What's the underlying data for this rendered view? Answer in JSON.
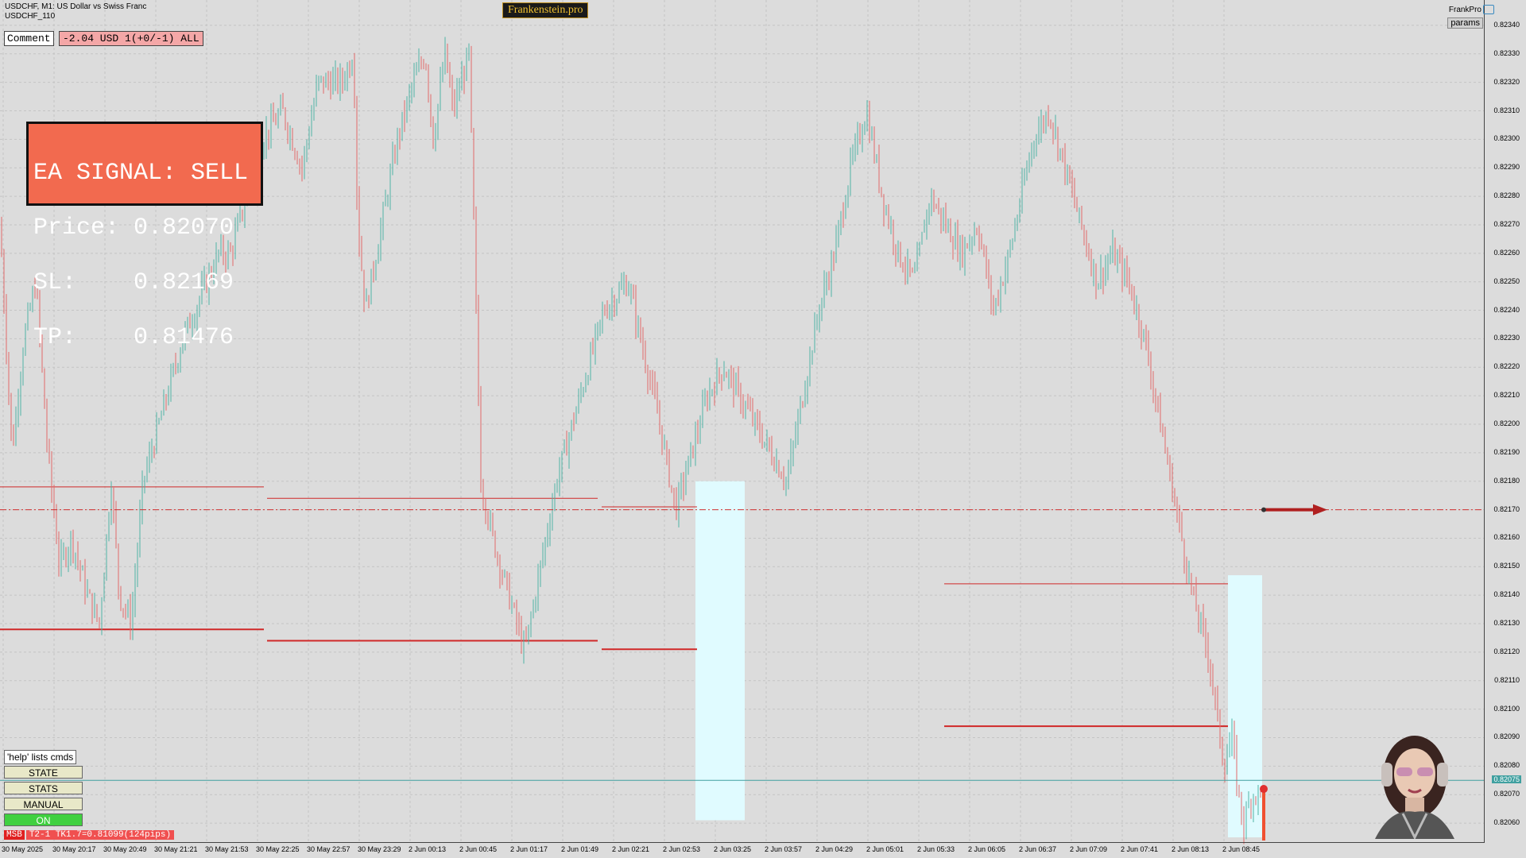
{
  "header": {
    "symbol_line": "USDCHF, M1:  US Dollar vs Swiss Franc",
    "sub_line": "USDCHF_110",
    "brand": "Frankenstein.pro",
    "frankpro_label": "FrankPro",
    "params_label": "params"
  },
  "comment": {
    "label": "Comment",
    "value": "-2.04 USD 1(+0/-1) ALL"
  },
  "signal": {
    "line1": "EA SIGNAL: SELL",
    "line2": "Price: 0.82070",
    "line3": "SL:    0.82169",
    "line4": "TP:    0.81476"
  },
  "panel": {
    "help": "'help' lists cmds",
    "state": "STATE",
    "stats": "STATS",
    "manual": "MANUAL",
    "on": "ON"
  },
  "status": {
    "tag": "MSB",
    "text": "T2-1  TK1.7=0.81099(124pips)"
  },
  "price_axis": {
    "labels": [
      "0.82340",
      "0.82330",
      "0.82320",
      "0.82310",
      "0.82300",
      "0.82290",
      "0.82280",
      "0.82270",
      "0.82260",
      "0.82250",
      "0.82240",
      "0.82230",
      "0.82220",
      "0.82210",
      "0.82200",
      "0.82190",
      "0.82180",
      "0.82170",
      "0.82160",
      "0.82150",
      "0.82140",
      "0.82130",
      "0.82120",
      "0.82110",
      "0.82100",
      "0.82090",
      "0.82080",
      "0.82070",
      "0.82060"
    ],
    "current_price": "0.82075"
  },
  "time_axis": {
    "labels": [
      "30 May 2025",
      "30 May 20:17",
      "30 May 20:49",
      "30 May 21:21",
      "30 May 21:53",
      "30 May 22:25",
      "30 May 22:57",
      "30 May 23:29",
      "2 Jun 00:13",
      "2 Jun 00:45",
      "2 Jun 01:17",
      "2 Jun 01:49",
      "2 Jun 02:21",
      "2 Jun 02:53",
      "2 Jun 03:25",
      "2 Jun 03:57",
      "2 Jun 04:29",
      "2 Jun 05:01",
      "2 Jun 05:33",
      "2 Jun 06:05",
      "2 Jun 06:37",
      "2 Jun 07:09",
      "2 Jun 07:41",
      "2 Jun 08:13",
      "2 Jun 08:45"
    ]
  },
  "chart_data": {
    "type": "candlestick",
    "symbol": "USDCHF",
    "timeframe": "M1",
    "ylim": [
      0.82055,
      0.82345
    ],
    "signal_price": 0.8217,
    "current_price": 0.82075,
    "up_color": "#4fb3a6",
    "down_color": "#e26a6a",
    "price_path": [
      [
        0,
        0.8227
      ],
      [
        15,
        0.8219
      ],
      [
        30,
        0.8223
      ],
      [
        45,
        0.8225
      ],
      [
        60,
        0.8219
      ],
      [
        75,
        0.8215
      ],
      [
        90,
        0.8216
      ],
      [
        110,
        0.8214
      ],
      [
        125,
        0.8213
      ],
      [
        140,
        0.8218
      ],
      [
        150,
        0.8214
      ],
      [
        165,
        0.8213
      ],
      [
        180,
        0.8218
      ],
      [
        200,
        0.822
      ],
      [
        230,
        0.8223
      ],
      [
        260,
        0.8225
      ],
      [
        275,
        0.8226
      ],
      [
        290,
        0.8226
      ],
      [
        310,
        0.8228
      ],
      [
        330,
        0.823
      ],
      [
        355,
        0.8231
      ],
      [
        380,
        0.8229
      ],
      [
        400,
        0.8232
      ],
      [
        430,
        0.8232
      ],
      [
        445,
        0.8233
      ],
      [
        450,
        0.8227
      ],
      [
        460,
        0.8224
      ],
      [
        480,
        0.8227
      ],
      [
        500,
        0.823
      ],
      [
        520,
        0.8232
      ],
      [
        535,
        0.8233
      ],
      [
        545,
        0.823
      ],
      [
        560,
        0.8233
      ],
      [
        570,
        0.8231
      ],
      [
        590,
        0.8233
      ],
      [
        605,
        0.8218
      ],
      [
        620,
        0.8216
      ],
      [
        640,
        0.8214
      ],
      [
        660,
        0.8212
      ],
      [
        680,
        0.8215
      ],
      [
        700,
        0.8218
      ],
      [
        720,
        0.822
      ],
      [
        740,
        0.8222
      ],
      [
        760,
        0.8224
      ],
      [
        790,
        0.8225
      ],
      [
        830,
        0.822
      ],
      [
        850,
        0.8217
      ],
      [
        870,
        0.8219
      ],
      [
        890,
        0.8221
      ],
      [
        910,
        0.8222
      ],
      [
        930,
        0.8221
      ],
      [
        950,
        0.822
      ],
      [
        970,
        0.8219
      ],
      [
        990,
        0.8218
      ],
      [
        1010,
        0.8221
      ],
      [
        1030,
        0.8224
      ],
      [
        1050,
        0.8226
      ],
      [
        1070,
        0.8229
      ],
      [
        1090,
        0.8231
      ],
      [
        1110,
        0.8228
      ],
      [
        1130,
        0.8226
      ],
      [
        1150,
        0.8225
      ],
      [
        1170,
        0.8228
      ],
      [
        1190,
        0.8227
      ],
      [
        1210,
        0.8226
      ],
      [
        1230,
        0.8227
      ],
      [
        1250,
        0.8224
      ],
      [
        1270,
        0.8226
      ],
      [
        1285,
        0.8228
      ],
      [
        1300,
        0.823
      ],
      [
        1320,
        0.8231
      ],
      [
        1340,
        0.8229
      ],
      [
        1360,
        0.8227
      ],
      [
        1380,
        0.8225
      ],
      [
        1400,
        0.8226
      ],
      [
        1420,
        0.8225
      ],
      [
        1440,
        0.8223
      ],
      [
        1460,
        0.822
      ],
      [
        1480,
        0.8217
      ],
      [
        1500,
        0.8214
      ],
      [
        1520,
        0.8212
      ],
      [
        1530,
        0.821
      ],
      [
        1540,
        0.8208
      ],
      [
        1550,
        0.8209
      ],
      [
        1558,
        0.8207
      ],
      [
        1565,
        0.8206
      ],
      [
        1575,
        0.8207
      ],
      [
        1585,
        0.8207
      ]
    ],
    "sr_lines": [
      {
        "x1": 0,
        "x2": 332,
        "y": 0.82178,
        "w": 1
      },
      {
        "x1": 0,
        "x2": 332,
        "y": 0.82128,
        "w": 2
      },
      {
        "x1": 336,
        "x2": 752,
        "y": 0.82174,
        "w": 1
      },
      {
        "x1": 336,
        "x2": 752,
        "y": 0.82124,
        "w": 2
      },
      {
        "x1": 757,
        "x2": 877,
        "y": 0.82171,
        "w": 1
      },
      {
        "x1": 757,
        "x2": 877,
        "y": 0.82121,
        "w": 2
      },
      {
        "x1": 1188,
        "x2": 1545,
        "y": 0.82144,
        "w": 1
      },
      {
        "x1": 1188,
        "x2": 1545,
        "y": 0.82094,
        "w": 2
      }
    ],
    "zones": [
      {
        "x1": 875,
        "x2": 937,
        "y1": 0.8218,
        "y2": 0.82061
      },
      {
        "x1": 1545,
        "x2": 1588,
        "y1": 0.82147,
        "y2": 0.82055
      }
    ]
  }
}
